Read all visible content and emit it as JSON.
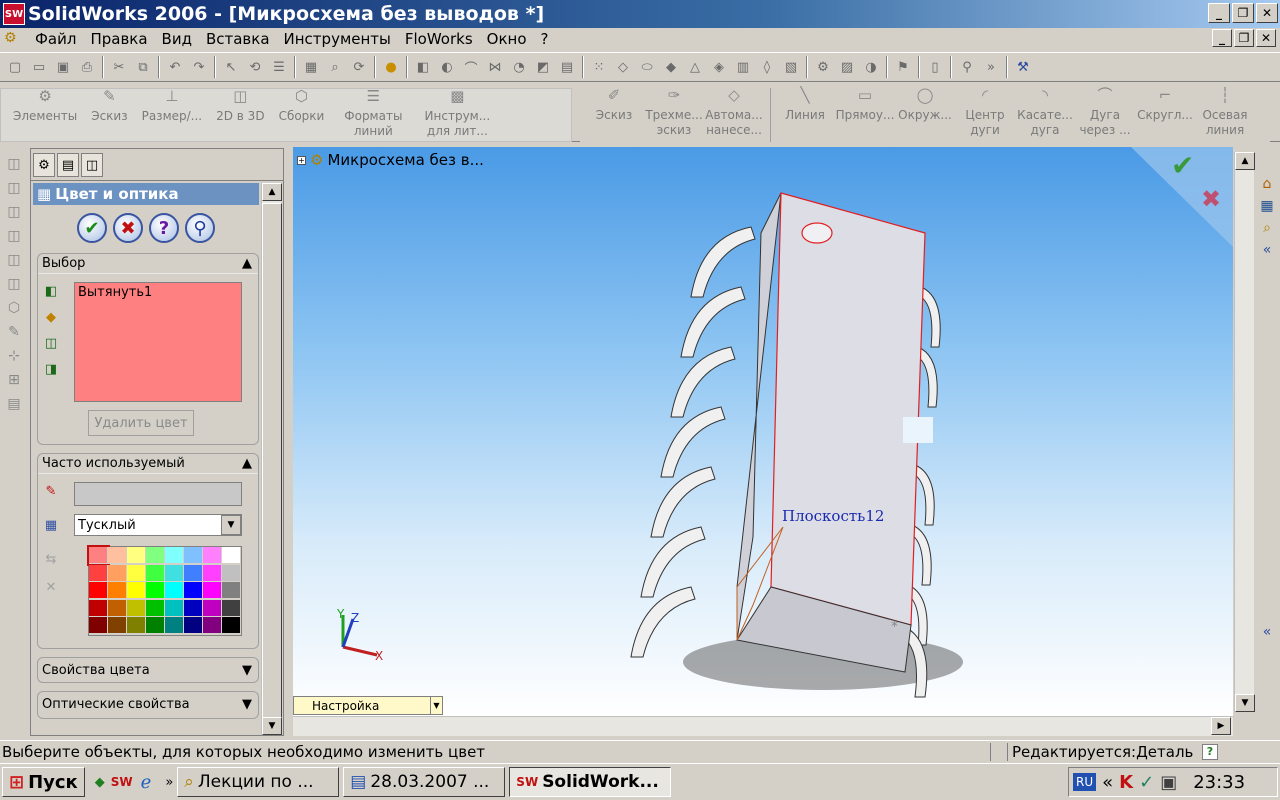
{
  "window": {
    "title": "SolidWorks 2006 - [Микросхема без выводов *]",
    "app_icon": "SW"
  },
  "menu": [
    "Файл",
    "Правка",
    "Вид",
    "Вставка",
    "Инструменты",
    "FloWorks",
    "Окно",
    "?"
  ],
  "command_manager": {
    "group1": [
      {
        "label": "Элементы",
        "icon": "features-icon"
      },
      {
        "label": "Эскиз",
        "icon": "sketch-icon"
      },
      {
        "label": "Размер/...",
        "icon": "dimension-icon"
      },
      {
        "label": "2D в 3D",
        "icon": "2d-to-3d-icon"
      },
      {
        "label": "Сборки",
        "icon": "assembly-icon"
      },
      {
        "label": "Форматы линий",
        "icon": "line-format-icon"
      },
      {
        "label": "Инструм... для лит...",
        "icon": "mold-tools-icon"
      }
    ],
    "group2": [
      {
        "label": "Эскиз",
        "icon": "sketch-icon"
      },
      {
        "label": "Трехме... эскиз",
        "icon": "3d-sketch-icon"
      },
      {
        "label": "Автома... нанесе...",
        "icon": "auto-dim-icon"
      }
    ],
    "group3": [
      {
        "label": "Линия",
        "icon": "line-icon"
      },
      {
        "label": "Прямоу...",
        "icon": "rectangle-icon"
      },
      {
        "label": "Окруж...",
        "icon": "circle-icon"
      },
      {
        "label": "Центр дуги",
        "icon": "center-arc-icon"
      },
      {
        "label": "Касате... дуга",
        "icon": "tangent-arc-icon"
      },
      {
        "label": "Дуга через ...",
        "icon": "3point-arc-icon"
      },
      {
        "label": "Скругл...",
        "icon": "fillet-icon"
      },
      {
        "label": "Осевая линия",
        "icon": "centerline-icon"
      }
    ]
  },
  "panel": {
    "title": "Цвет и оптика",
    "selection": {
      "header": "Выбор",
      "items": [
        "Вытянуть1"
      ],
      "remove_button": "Удалить цвет",
      "list_color": "#ff8080"
    },
    "favorites": {
      "header": "Часто используемый",
      "finish_value": "Тусклый",
      "color_value": ""
    },
    "color_props": "Свойства цвета",
    "optical_props": "Оптические свойства",
    "palette": [
      "#ff8080",
      "#ffc0a0",
      "#ffff80",
      "#80ff80",
      "#80ffff",
      "#80c0ff",
      "#ff80ff",
      "#ffffff",
      "#ff4040",
      "#ffa060",
      "#ffff40",
      "#40ff40",
      "#40e0e0",
      "#4080ff",
      "#ff40ff",
      "#c0c0c0",
      "#ff0000",
      "#ff8000",
      "#ffff00",
      "#00ff00",
      "#00ffff",
      "#0000ff",
      "#ff00ff",
      "#808080",
      "#c00000",
      "#c06000",
      "#c0c000",
      "#00c000",
      "#00c0c0",
      "#0000c0",
      "#c000c0",
      "#404040",
      "#800000",
      "#804000",
      "#808000",
      "#008000",
      "#008080",
      "#000080",
      "#800080",
      "#000000"
    ]
  },
  "viewport": {
    "tree_label": "Микросхема без в...",
    "plane_label": "Плоскость12",
    "axis_labels": {
      "x": "X",
      "y": "Y",
      "z": "Z"
    },
    "config_tab": "Настройка"
  },
  "status": {
    "message": "Выберите объекты, для которых необходимо изменить цвет",
    "mode": "Редактируется:Деталь"
  },
  "taskbar": {
    "start": "Пуск",
    "tasks": [
      {
        "label": "Лекции по ...",
        "active": false
      },
      {
        "label": "28.03.2007 ...",
        "active": false
      },
      {
        "label": "SolidWork...",
        "active": true
      }
    ],
    "lang": "RU",
    "time": "23:33"
  }
}
